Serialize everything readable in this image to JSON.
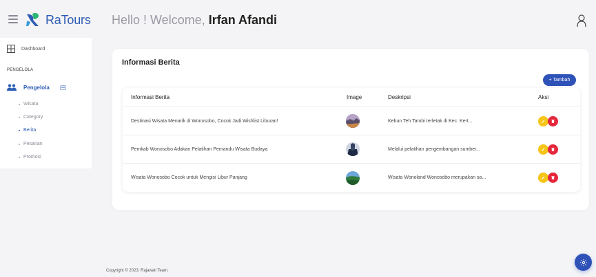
{
  "app": {
    "name": "RaTours",
    "brand_color": "#2e5db5",
    "accent_color": "#2e52b8"
  },
  "header": {
    "greeting_prefix": "Hello ! Welcome, ",
    "user_name": "Irfan Afandi",
    "menu_icon": "hamburger-icon",
    "user_icon": "user-icon"
  },
  "sidebar": {
    "dashboard_label": "Dashboard",
    "section_label": "PENGELOLA",
    "group_label": "Pengelola",
    "items": [
      {
        "label": "Wisata",
        "active": false
      },
      {
        "label": "Category",
        "active": false
      },
      {
        "label": "Berita",
        "active": true
      },
      {
        "label": "Pesanan",
        "active": false
      },
      {
        "label": "Promosi",
        "active": false
      }
    ]
  },
  "main": {
    "title": "Informasi Berita",
    "add_button_label": "+ Tambah",
    "columns": [
      "Informasi Berita",
      "Image",
      "Deskripsi",
      "Aksi"
    ],
    "rows": [
      {
        "info": "Destinasi Wisata Menarik di Wonosobo, Cocok Jadi Wishlist Liburan!",
        "image": "landscape-thumbnail",
        "deskripsi": "Kebun Teh Tambi terletak di Kec. Kert..."
      },
      {
        "info": "Pemkab Wonosobo Adakan Pelatihan Pemandu Wisata Budaya",
        "image": "people-thumbnail",
        "deskripsi": "Melalui pelatihan pengembangan sumber..."
      },
      {
        "info": "Wisata Wonosobo Cocok untuk Mengisi Libur Panjang",
        "image": "nature-thumbnail",
        "deskripsi": "Wisata Wonoland Wonosobo merupakan sa..."
      }
    ],
    "edit_color": "#f5c518",
    "delete_color": "#e5273d"
  },
  "footer": {
    "copyright": "Copyright © 2023. Rajawali Team."
  },
  "fab": {
    "icon": "gear-icon"
  }
}
